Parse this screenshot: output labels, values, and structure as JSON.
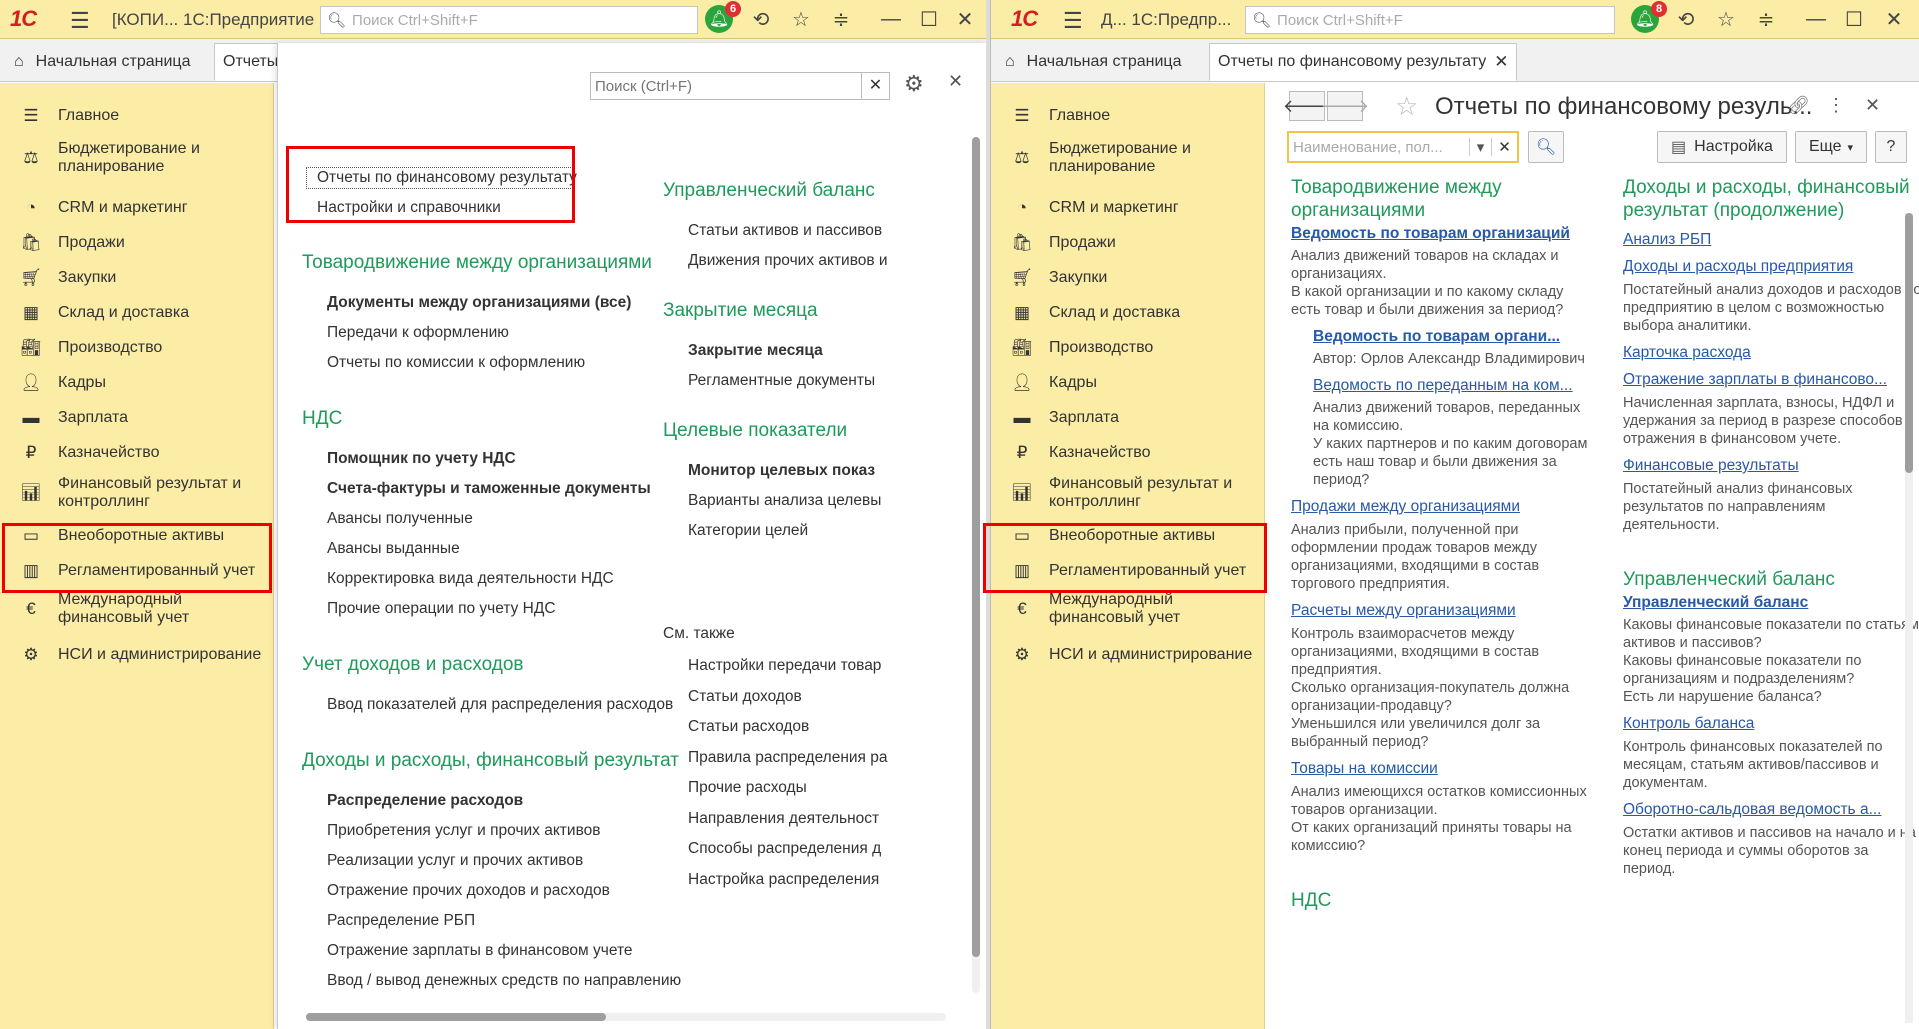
{
  "left": {
    "app_title": "[КОПИ...  1С:Предприятие",
    "search_placeholder": "Поиск Ctrl+Shift+F",
    "notifications": "6",
    "tabs": [
      "Начальная страница",
      "Отчеты"
    ],
    "popup": {
      "search_placeholder": "Поиск (Ctrl+F)",
      "top_links": [
        "Отчеты по финансовому результату",
        "Настройки и справочники"
      ],
      "col1": [
        {
          "heading": "Товародвижение между организациями",
          "links": [
            {
              "text": "Документы между организациями (все)",
              "bold": true
            },
            {
              "text": "Передачи к оформлению",
              "bold": false
            },
            {
              "text": "Отчеты по комиссии к оформлению",
              "bold": false
            }
          ]
        },
        {
          "heading": "НДС",
          "links": [
            {
              "text": "Помощник по учету НДС",
              "bold": true
            },
            {
              "text": "Счета-фактуры и таможенные документы",
              "bold": true
            },
            {
              "text": "Авансы полученные",
              "bold": false
            },
            {
              "text": "Авансы выданные",
              "bold": false
            },
            {
              "text": "Корректировка вида деятельности НДС",
              "bold": false
            },
            {
              "text": "Прочие операции по учету НДС",
              "bold": false
            }
          ]
        },
        {
          "heading": "Учет доходов и расходов",
          "links": [
            {
              "text": "Ввод показателей для распределения расходов",
              "bold": false
            }
          ]
        },
        {
          "heading": "Доходы и расходы, финансовый результат",
          "links": [
            {
              "text": "Распределение расходов",
              "bold": true
            },
            {
              "text": "Приобретения услуг и прочих активов",
              "bold": false
            },
            {
              "text": "Реализации услуг и прочих активов",
              "bold": false
            },
            {
              "text": "Отражение прочих доходов и расходов",
              "bold": false
            },
            {
              "text": "Распределение РБП",
              "bold": false
            },
            {
              "text": "Отражение зарплаты в финансовом учете",
              "bold": false
            },
            {
              "text": "Ввод / вывод денежных средств по направлению",
              "bold": false
            }
          ]
        }
      ],
      "col2": [
        {
          "heading": "Управленческий баланс",
          "links": [
            {
              "text": "Статьи активов и пассивов",
              "bold": false
            },
            {
              "text": "Движения прочих активов и",
              "bold": false
            }
          ]
        },
        {
          "heading": "Закрытие месяца",
          "links": [
            {
              "text": "Закрытие месяца",
              "bold": true
            },
            {
              "text": "Регламентные документы",
              "bold": false
            }
          ]
        },
        {
          "heading": "Целевые показатели",
          "links": [
            {
              "text": "Монитор целевых показ",
              "bold": true
            },
            {
              "text": "Варианты анализа целевы",
              "bold": false
            },
            {
              "text": "Категории целей",
              "bold": false
            }
          ]
        }
      ],
      "see_also_title": "См. также",
      "see_also": [
        "Настройки передачи товар",
        "Статьи доходов",
        "Статьи расходов",
        "Правила распределения ра",
        "Прочие расходы",
        "Направления деятельност",
        "Способы распределения д",
        "Настройка распределения"
      ]
    }
  },
  "right": {
    "app_title": "Д...  1С:Предпр...",
    "search_placeholder": "Поиск Ctrl+Shift+F",
    "notifications": "8",
    "tabs": [
      "Начальная страница",
      "Отчеты по финансовому результату"
    ],
    "form": {
      "title": "Отчеты по финансовому резуль...",
      "search_placeholder": "Наименование, пол...",
      "settings_btn": "Настройка",
      "more_btn": "Еще",
      "help_btn": "?",
      "col1": [
        {
          "type": "h",
          "text": "Товародвижение между организациями"
        },
        {
          "type": "lb",
          "text": "Ведомость по товарам организаций"
        },
        {
          "type": "d",
          "text": "Анализ движений товаров на складах и организациях.\nВ какой организации и по какому складу есть товар и были движения за период?"
        },
        {
          "type": "lbi",
          "text": "Ведомость по товарам органи..."
        },
        {
          "type": "di",
          "text": "Автор: Орлов Александр Владимирович"
        },
        {
          "type": "li",
          "text": "Ведомость по переданным на ком..."
        },
        {
          "type": "di",
          "text": "Анализ движений товаров, переданных на комиссию.\nУ каких партнеров и по каким договорам есть наш товар и были движения за период?"
        },
        {
          "type": "l",
          "text": "Продажи между организациями"
        },
        {
          "type": "d",
          "text": "Анализ прибыли, полученной при оформлении продаж товаров между организациями, входящими в состав торгового предприятия."
        },
        {
          "type": "l",
          "text": "Расчеты между организациями"
        },
        {
          "type": "d",
          "text": "Контроль взаиморасчетов между организациями, входящими в состав предприятия.\nСколько организация-покупатель должна организации-продавцу?\nУменьшился или увеличился долг за выбранный период?"
        },
        {
          "type": "l",
          "text": "Товары на комиссии"
        },
        {
          "type": "d",
          "text": "Анализ имеющихся остатков комиссионных товаров организации.\nОт каких организаций приняты товары на комиссию?"
        },
        {
          "type": "h",
          "text": "НДС"
        }
      ],
      "col2": [
        {
          "type": "h",
          "text": "Доходы и расходы, финансовый результат (продолжение)"
        },
        {
          "type": "l",
          "text": "Анализ РБП"
        },
        {
          "type": "l",
          "text": "Доходы и расходы предприятия"
        },
        {
          "type": "d",
          "text": "Постатейный анализ доходов и расходов по предприятию в целом с возможностью выбора аналитики."
        },
        {
          "type": "l",
          "text": "Карточка расхода"
        },
        {
          "type": "l",
          "text": "Отражение зарплаты в финансово..."
        },
        {
          "type": "d",
          "text": "Начисленная зарплата, взносы, НДФЛ и удержания за период в разрезе способов отражения в финансовом учете."
        },
        {
          "type": "l",
          "text": "Финансовые результаты"
        },
        {
          "type": "d",
          "text": "Постатейный анализ финансовых результатов по направлениям деятельности."
        },
        {
          "type": "h",
          "text": "Управленческий баланс"
        },
        {
          "type": "lb",
          "text": "Управленческий баланс"
        },
        {
          "type": "d",
          "text": "Каковы финансовые показатели по статьям активов и пассивов?\nКаковы финансовые показатели по организациям и подразделениям?\nЕсть ли нарушение баланса?"
        },
        {
          "type": "l",
          "text": "Контроль баланса"
        },
        {
          "type": "d",
          "text": "Контроль финансовых показателей по месяцам, статьям активов/пассивов и документам."
        },
        {
          "type": "l",
          "text": "Оборотно-сальдовая ведомость а..."
        },
        {
          "type": "d",
          "text": "Остатки активов и пассивов на начало и на конец периода и суммы оборотов за период."
        }
      ]
    }
  },
  "sidebar": [
    {
      "label": "Главное",
      "icon": "menu-icon"
    },
    {
      "label": "Бюджетирование и планирование",
      "icon": "budget-icon"
    },
    {
      "label": "CRM и маркетинг",
      "icon": "crm-icon"
    },
    {
      "label": "Продажи",
      "icon": "bag-icon"
    },
    {
      "label": "Закупки",
      "icon": "cart-icon"
    },
    {
      "label": "Склад и доставка",
      "icon": "warehouse-icon"
    },
    {
      "label": "Производство",
      "icon": "factory-icon"
    },
    {
      "label": "Кадры",
      "icon": "person-icon"
    },
    {
      "label": "Зарплата",
      "icon": "salary-icon"
    },
    {
      "label": "Казначейство",
      "icon": "treasury-icon"
    },
    {
      "label": "Финансовый результат и контроллинг",
      "icon": "chart-icon"
    },
    {
      "label": "Внеоборотные активы",
      "icon": "assets-icon"
    },
    {
      "label": "Регламентированный учет",
      "icon": "accounting-icon"
    },
    {
      "label": "Международный финансовый учет",
      "icon": "ifrs-icon"
    },
    {
      "label": "НСИ и администрирование",
      "icon": "gear-icon"
    }
  ],
  "logo": "1С"
}
